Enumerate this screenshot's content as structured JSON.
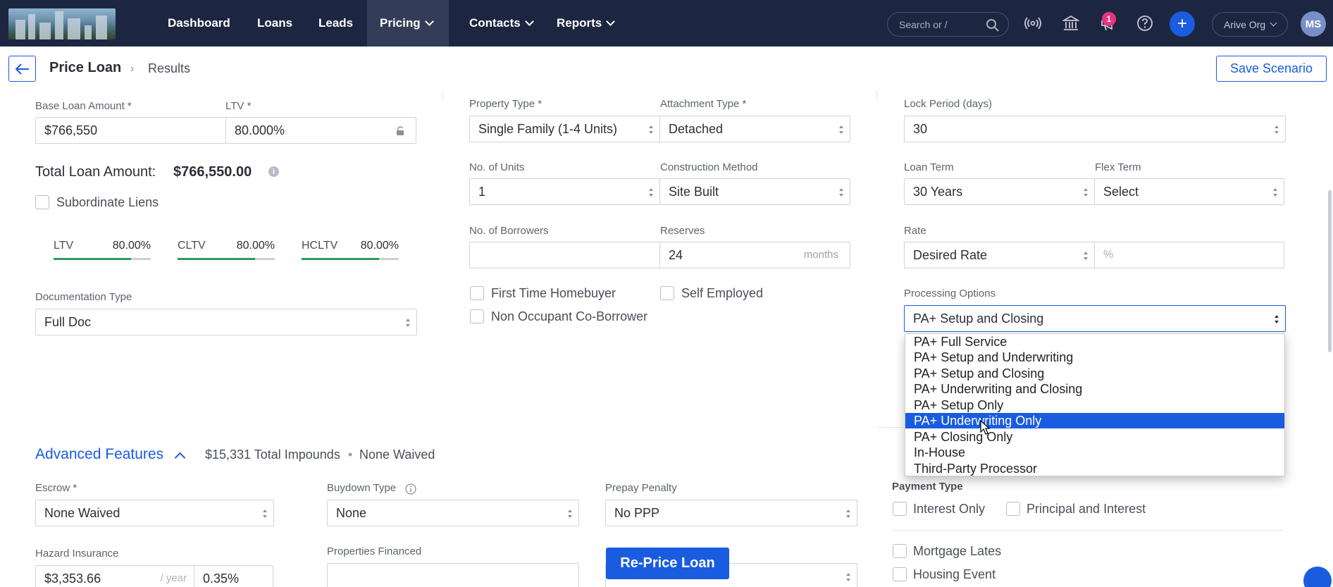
{
  "nav": {
    "items": [
      {
        "label": "Dashboard",
        "dropdown": false,
        "active": false
      },
      {
        "label": "Loans",
        "dropdown": false,
        "active": false
      },
      {
        "label": "Leads",
        "dropdown": false,
        "active": false
      },
      {
        "label": "Pricing",
        "dropdown": true,
        "active": true
      },
      {
        "label": "Contacts",
        "dropdown": true,
        "active": false
      },
      {
        "label": "Reports",
        "dropdown": true,
        "active": false
      }
    ],
    "search_placeholder": "Search or /",
    "notification_count": "1",
    "plus_label": "+",
    "org_label": "Arive Org",
    "avatar_initials": "MS"
  },
  "header": {
    "title": "Price Loan",
    "breadcrumb_sep": "›",
    "breadcrumb": "Results",
    "save_label": "Save Scenario"
  },
  "loan": {
    "base_amount_label": "Base Loan Amount *",
    "base_amount": "$766,550",
    "ltv_label": "LTV *",
    "ltv": "80.000%",
    "total_label": "Total Loan Amount:",
    "total_value": "$766,550.00",
    "subordinate_label": "Subordinate Liens",
    "ratios": [
      {
        "label": "LTV",
        "value": "80.00%",
        "fill": 0.8
      },
      {
        "label": "CLTV",
        "value": "80.00%",
        "fill": 0.8
      },
      {
        "label": "HCLTV",
        "value": "80.00%",
        "fill": 0.8
      }
    ],
    "doc_type_label": "Documentation Type",
    "doc_type": "Full Doc"
  },
  "property": {
    "type_label": "Property Type *",
    "type": "Single Family (1-4 Units)",
    "attachment_label": "Attachment Type *",
    "attachment": "Detached",
    "units_label": "No. of Units",
    "units": "1",
    "construction_label": "Construction Method",
    "construction": "Site Built",
    "borrowers_label": "No. of Borrowers",
    "borrowers": "",
    "reserves_label": "Reserves",
    "reserves": "24",
    "reserves_unit": "months",
    "first_time_label": "First Time Homebuyer",
    "self_employed_label": "Self Employed",
    "non_occupant_label": "Non Occupant Co-Borrower"
  },
  "terms": {
    "lock_label": "Lock Period (days)",
    "lock": "30",
    "loan_term_label": "Loan Term",
    "loan_term": "30 Years",
    "flex_term_label": "Flex Term",
    "flex_term": "Select",
    "rate_label": "Rate",
    "rate_type": "Desired Rate",
    "rate_placeholder": "%",
    "processing_label": "Processing Options",
    "processing": "PA+ Setup and Closing",
    "processing_options": [
      "PA+ Full Service",
      "PA+ Setup and Underwriting",
      "PA+ Setup and Closing",
      "PA+ Underwriting and Closing",
      "PA+ Setup Only",
      "PA+ Underwriting Only",
      "PA+ Closing Only",
      "In-House",
      "Third-Party Processor"
    ],
    "highlighted_index": 5
  },
  "advanced": {
    "title": "Advanced Features",
    "impounds": "$15,331 Total Impounds",
    "dot": "•",
    "waived": "None Waived",
    "escrow_label": "Escrow *",
    "escrow": "None Waived",
    "buydown_label": "Buydown Type",
    "buydown": "None",
    "prepay_label": "Prepay Penalty",
    "prepay": "No PPP",
    "hazard_label": "Hazard Insurance",
    "hazard_amount": "$3,353.66",
    "hazard_unit": "/ year",
    "hazard_pct": "0.35%",
    "properties_label": "Properties Financed",
    "properties": "",
    "reprice_label": "Re-Price Loan",
    "payment_type_label": "Payment Type",
    "interest_only_label": "Interest Only",
    "principal_interest_label": "Principal and Interest",
    "mortgage_lates_label": "Mortgage Lates",
    "housing_event_label": "Housing Event"
  },
  "colors": {
    "nav_bg": "#1d2640",
    "accent": "#1a5ce0",
    "ratio_fill": "#2f9a5e",
    "badge": "#e8337d"
  }
}
